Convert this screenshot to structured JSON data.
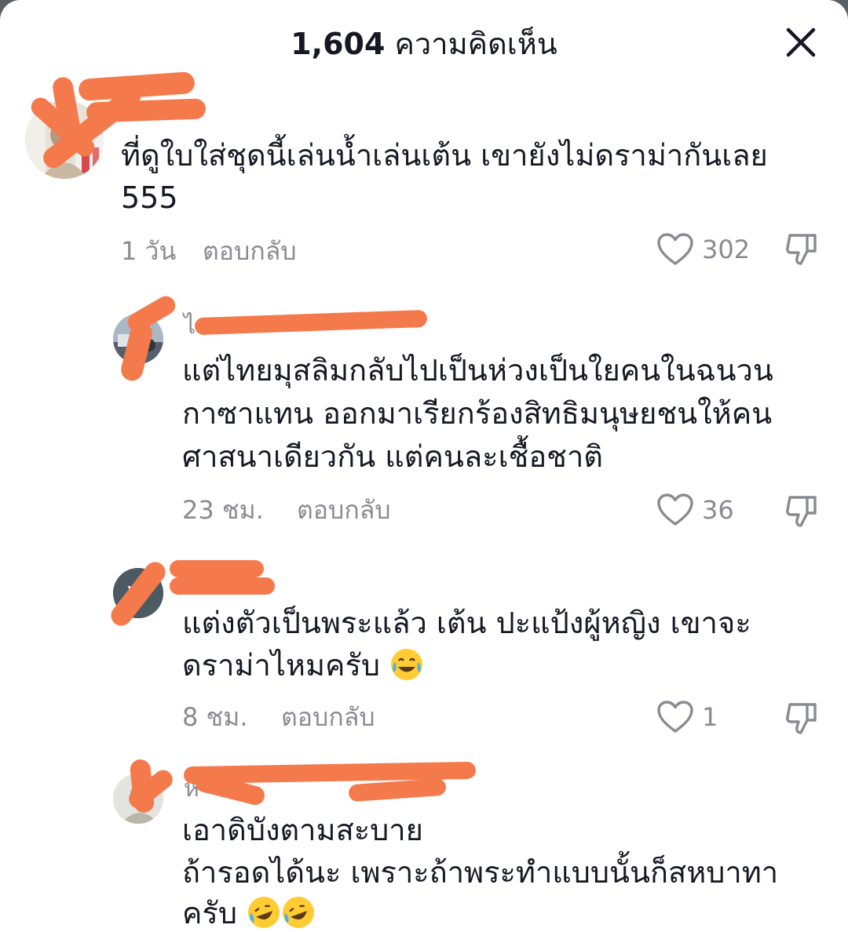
{
  "header": {
    "comment_count": "1,604",
    "comment_label": "ความคิดเห็น"
  },
  "reply_label": "ตอบกลับ",
  "colors": {
    "redaction": "#f47a4c",
    "text": "#161823",
    "muted": "#8a8b91"
  },
  "comments": [
    {
      "username": "",
      "lines": [
        "ที่ดูใบใส่ชุดนี้เล่นน้ำเล่นเต้น เขายังไม่ดราม่ากันเลย",
        "555"
      ],
      "time": "1 วัน",
      "likes": "302",
      "avatar_icon": "user-avatar-photo"
    },
    {
      "username": "ไบ",
      "lines": [
        "แต่ไทยมุสลิมกลับไปเป็นห่วงเป็นใยคนในฉนวน",
        "กาซาแทน ออกมาเรียกร้องสิทธิมนุษยชนให้คน",
        "ศาสนาเดียวกัน แต่คนละเชื้อชาติ"
      ],
      "time": "23 ชม.",
      "likes": "36",
      "avatar_icon": "user-avatar-photo"
    },
    {
      "username": "",
      "avatar_letter": "W",
      "lines": [
        "แต่งตัวเป็นพระแล้ว เต้น ปะแป้งผู้หญิง เขาจะ",
        "ดราม่าไหมครับ"
      ],
      "time": "8 ชม.",
      "likes": "1",
      "avatar_icon": "letter-avatar"
    },
    {
      "username": "ห",
      "lines": [
        "เอาดิบังตามสะบาย",
        "ถ้ารอดได้นะ เพราะถ้าพระทำแบบนั้นก็สหบาทา",
        "ครับ"
      ],
      "avatar_icon": "user-avatar-photo"
    }
  ]
}
